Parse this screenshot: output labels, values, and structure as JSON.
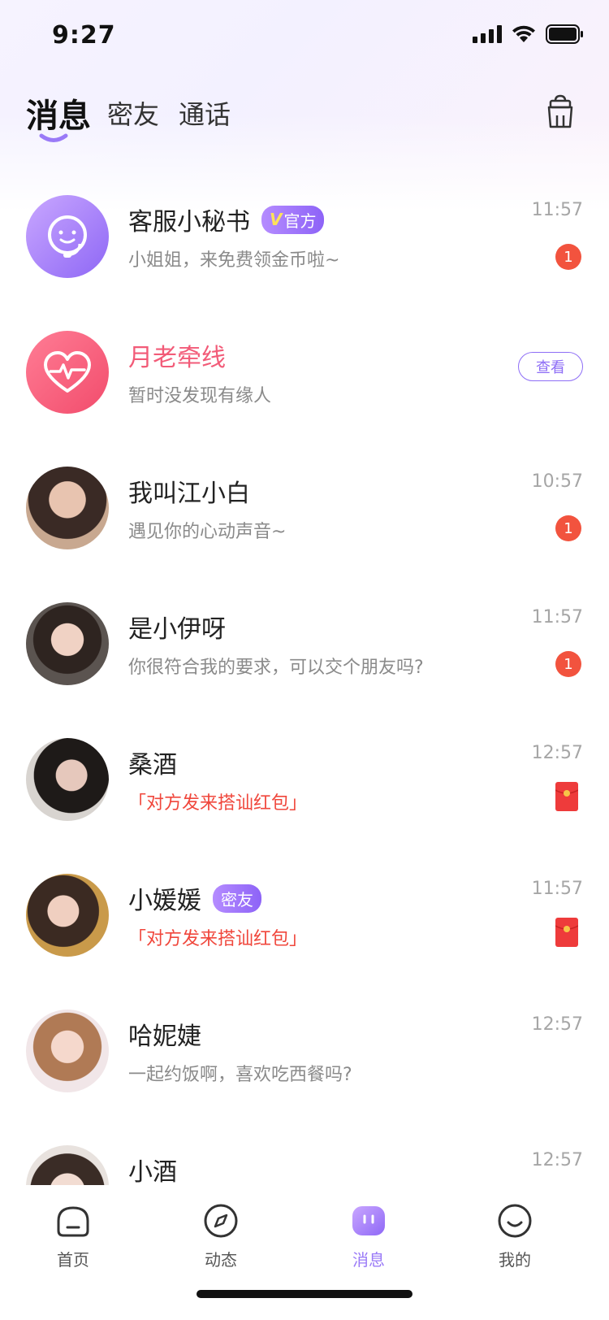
{
  "status": {
    "time": "9:27"
  },
  "header": {
    "tabs": [
      {
        "label": "消息",
        "active": true
      },
      {
        "label": "密友",
        "active": false
      },
      {
        "label": "通话",
        "active": false
      }
    ],
    "clean_icon": "broom-basket-icon"
  },
  "colors": {
    "accent": "#9a7af7",
    "unread": "#f2533e",
    "pink": "#f25b78",
    "redpacket": "#ee3b3b"
  },
  "conversations": [
    {
      "name": "客服小秘书",
      "badge": "官方",
      "badge_v": "V",
      "message": "小姐姐，来免费领金币啦~",
      "time": "11:57",
      "unread": "1",
      "avatar": "service-agent-icon"
    },
    {
      "name": "月老牵线",
      "message": "暂时没发现有缘人",
      "action": "查看",
      "avatar": "heart-pulse-icon"
    },
    {
      "name": "我叫江小白",
      "message": "遇见你的心动声音~",
      "time": "10:57",
      "unread": "1",
      "avatar": "user-photo"
    },
    {
      "name": "是小伊呀",
      "message": "你很符合我的要求，可以交个朋友吗?",
      "time": "11:57",
      "unread": "1",
      "avatar": "user-photo"
    },
    {
      "name": "桑酒",
      "message": "「对方发来搭讪红包」",
      "time": "12:57",
      "avatar": "user-photo",
      "icon": "red-packet-icon"
    },
    {
      "name": "小媛媛",
      "badge": "密友",
      "message": "「对方发来搭讪红包」",
      "time": "11:57",
      "avatar": "user-photo",
      "icon": "red-packet-icon"
    },
    {
      "name": "哈妮婕",
      "message": "一起约饭啊，喜欢吃西餐吗?",
      "time": "12:57",
      "avatar": "user-photo"
    },
    {
      "name": "小酒",
      "time": "12:57",
      "avatar": "user-photo"
    }
  ],
  "nav": [
    {
      "label": "首页",
      "icon": "home-icon",
      "active": false
    },
    {
      "label": "动态",
      "icon": "compass-icon",
      "active": false
    },
    {
      "label": "消息",
      "icon": "message-icon",
      "active": true
    },
    {
      "label": "我的",
      "icon": "smile-icon",
      "active": false
    }
  ]
}
